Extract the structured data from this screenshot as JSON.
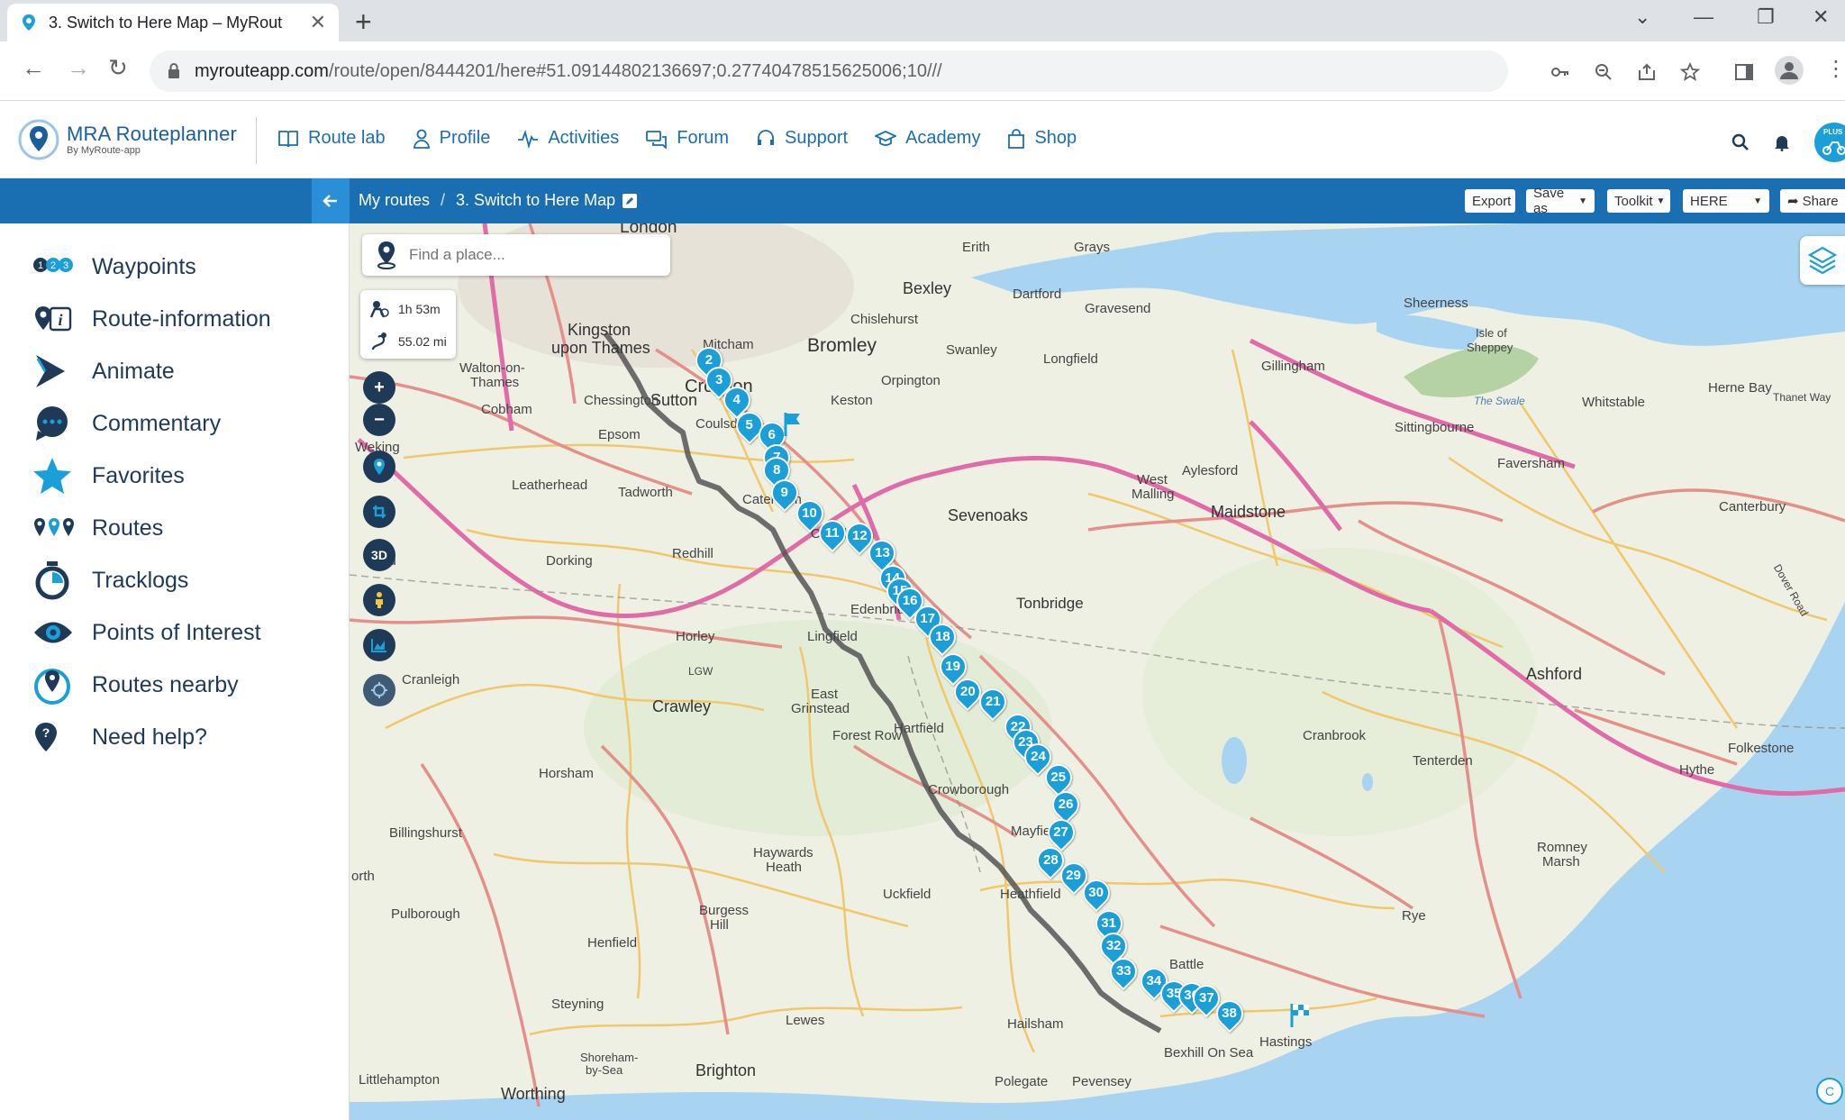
{
  "browser": {
    "tab_title": "3. Switch to Here Map – MyRout",
    "url_host": "myrouteapp.com",
    "url_path": "/route/open/8444201/here#51.09144802136697;0.27740478515625006;10///"
  },
  "header": {
    "brand_line1": "MRA Routeplanner",
    "brand_line2": "By MyRoute-app",
    "nav": [
      {
        "label": "Route lab",
        "icon": "book-icon"
      },
      {
        "label": "Profile",
        "icon": "person-icon"
      },
      {
        "label": "Activities",
        "icon": "pulse-icon"
      },
      {
        "label": "Forum",
        "icon": "chat-icon"
      },
      {
        "label": "Support",
        "icon": "headset-icon"
      },
      {
        "label": "Academy",
        "icon": "grad-cap-icon"
      },
      {
        "label": "Shop",
        "icon": "bag-icon"
      }
    ],
    "avatar_badge": "PLUS"
  },
  "toolbar": {
    "breadcrumb_root": "My routes",
    "breadcrumb_sep": "/",
    "route_name": "3. Switch to Here Map",
    "export_label": "Export",
    "save_label": "Save as",
    "toolkit_label": "Toolkit",
    "map_provider": "HERE",
    "share_label": "Share"
  },
  "sidebar": {
    "items": [
      {
        "label": "Waypoints",
        "icon": "waypoints-icon"
      },
      {
        "label": "Route-information",
        "icon": "route-info-icon"
      },
      {
        "label": "Animate",
        "icon": "play-icon"
      },
      {
        "label": "Commentary",
        "icon": "comment-icon"
      },
      {
        "label": "Favorites",
        "icon": "star-icon"
      },
      {
        "label": "Routes",
        "icon": "routes-icon"
      },
      {
        "label": "Tracklogs",
        "icon": "stopwatch-icon"
      },
      {
        "label": "Points of Interest",
        "icon": "eye-icon"
      },
      {
        "label": "Routes nearby",
        "icon": "nearby-icon"
      },
      {
        "label": "Need help?",
        "icon": "help-icon"
      }
    ]
  },
  "map": {
    "search_placeholder": "Find a place...",
    "duration": "1h 53m",
    "distance": "55.02 mi",
    "zoom_in": "+",
    "zoom_out": "−",
    "threed": "3D",
    "places": [
      {
        "name": "London"
      },
      {
        "name": "Erith"
      },
      {
        "name": "Grays"
      },
      {
        "name": "Bexley"
      },
      {
        "name": "Dartford"
      },
      {
        "name": "Gravesend"
      },
      {
        "name": "Sheerness"
      },
      {
        "name": "Isle of"
      },
      {
        "name": "Sheppey"
      },
      {
        "name": "Kingston"
      },
      {
        "name": "upon Thames"
      },
      {
        "name": "Mitcham"
      },
      {
        "name": "Bromley"
      },
      {
        "name": "Chislehurst"
      },
      {
        "name": "Swanley"
      },
      {
        "name": "Longfield"
      },
      {
        "name": "Gillingham"
      },
      {
        "name": "Walton-on-"
      },
      {
        "name": "Thames"
      },
      {
        "name": "Sutton"
      },
      {
        "name": "Croydon"
      },
      {
        "name": "Orpington"
      },
      {
        "name": "Chessington"
      },
      {
        "name": "Keston"
      },
      {
        "name": "Epsom"
      },
      {
        "name": "Cobham"
      },
      {
        "name": "Coulsdon"
      },
      {
        "name": "Leatherhead"
      },
      {
        "name": "Tadworth"
      },
      {
        "name": "Caterham"
      },
      {
        "name": "Sevenoaks"
      },
      {
        "name": "West"
      },
      {
        "name": "Malling"
      },
      {
        "name": "Aylesford"
      },
      {
        "name": "Maidstone"
      },
      {
        "name": "Sittingbourne"
      },
      {
        "name": "Faversham"
      },
      {
        "name": "Whitstable"
      },
      {
        "name": "Herne Bay"
      },
      {
        "name": "Canterbury"
      },
      {
        "name": "Redhill"
      },
      {
        "name": "Oxted"
      },
      {
        "name": "Dorking"
      },
      {
        "name": "Edenbridge"
      },
      {
        "name": "Tonbridge"
      },
      {
        "name": "Horley"
      },
      {
        "name": "Lingfield"
      },
      {
        "name": "LGW"
      },
      {
        "name": "Cranleigh"
      },
      {
        "name": "Crawley"
      },
      {
        "name": "East"
      },
      {
        "name": "Grinstead"
      },
      {
        "name": "Forest Row"
      },
      {
        "name": "Hartfield"
      },
      {
        "name": "Cranbrook"
      },
      {
        "name": "Ashford"
      },
      {
        "name": "Tenterden"
      },
      {
        "name": "Folkestone"
      },
      {
        "name": "Hythe"
      },
      {
        "name": "Horsham"
      },
      {
        "name": "Crowborough"
      },
      {
        "name": "Mayfield"
      },
      {
        "name": "Billingshurst"
      },
      {
        "name": "Haywards"
      },
      {
        "name": "Heath"
      },
      {
        "name": "Uckfield"
      },
      {
        "name": "Heathfield"
      },
      {
        "name": "Romney"
      },
      {
        "name": "Marsh"
      },
      {
        "name": "Pulborough"
      },
      {
        "name": "Burgess"
      },
      {
        "name": "Hill"
      },
      {
        "name": "Henfield"
      },
      {
        "name": "Rye"
      },
      {
        "name": "Battle"
      },
      {
        "name": "Steyning"
      },
      {
        "name": "Lewes"
      },
      {
        "name": "Hailsham"
      },
      {
        "name": "Bexhill On Sea"
      },
      {
        "name": "Hastings"
      },
      {
        "name": "Shoreham-"
      },
      {
        "name": "by-Sea"
      },
      {
        "name": "Brighton"
      },
      {
        "name": "Littlehampton"
      },
      {
        "name": "Worthing"
      },
      {
        "name": "Polegate"
      },
      {
        "name": "Pevensey"
      },
      {
        "name": "Weking"
      },
      {
        "name": "ord"
      },
      {
        "name": "orth"
      },
      {
        "name": "The Swale"
      },
      {
        "name": "Dover Road"
      },
      {
        "name": "Thanet Way"
      }
    ],
    "waypoints": [
      "2",
      "3",
      "4",
      "5",
      "6",
      "7",
      "8",
      "9",
      "10",
      "11",
      "12",
      "13",
      "14",
      "15",
      "16",
      "17",
      "18",
      "19",
      "20",
      "21",
      "22",
      "23",
      "24",
      "25",
      "26",
      "27",
      "28",
      "29",
      "30",
      "31",
      "32",
      "33",
      "34",
      "35",
      "36",
      "37",
      "38"
    ]
  }
}
